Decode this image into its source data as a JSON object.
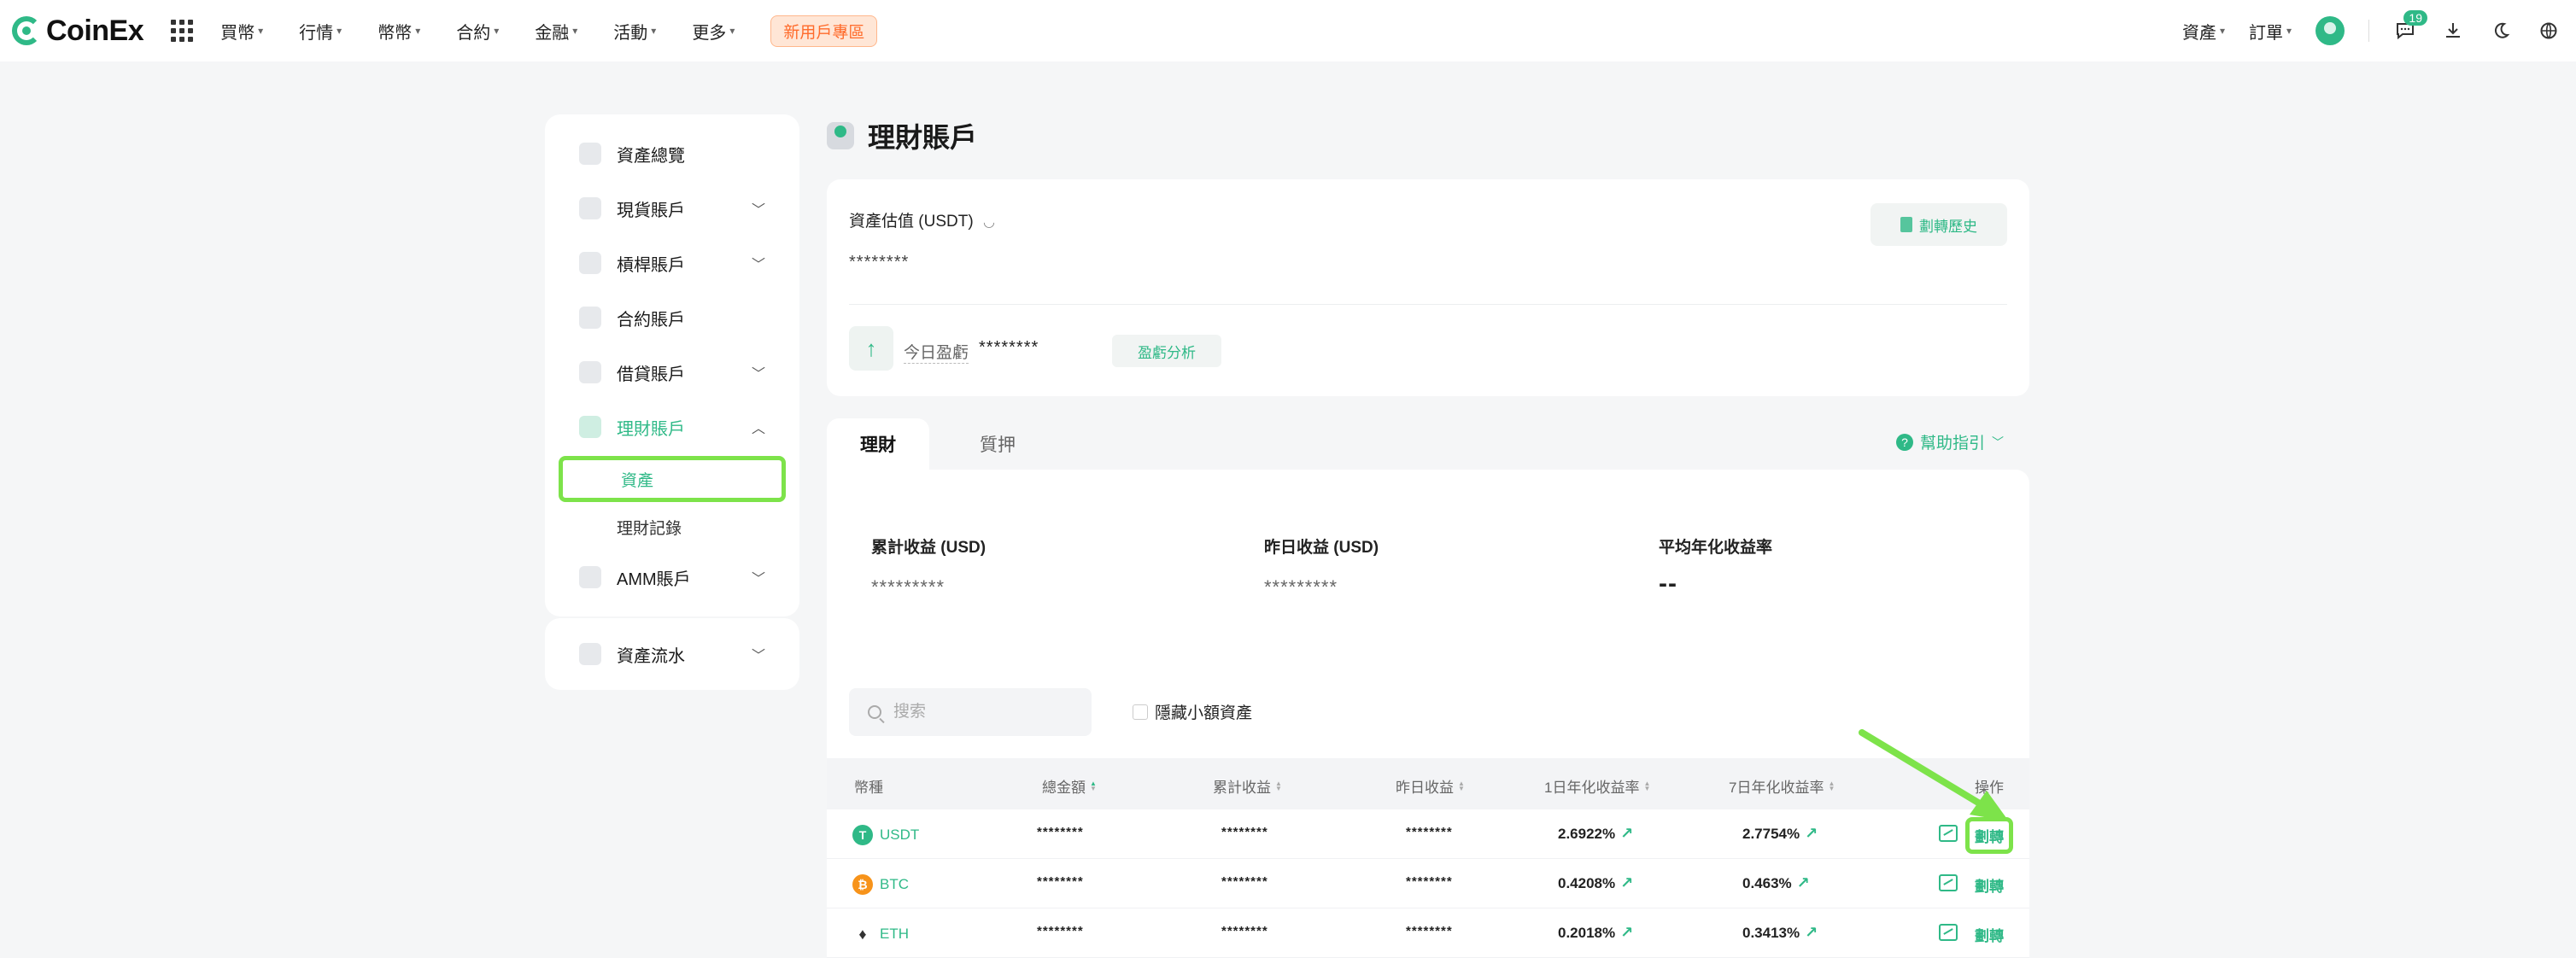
{
  "header": {
    "logo_text": "CoinEx",
    "nav": [
      "買幣",
      "行情",
      "幣幣",
      "合約",
      "金融",
      "活動",
      "更多"
    ],
    "promo": "新用戶專區",
    "right": {
      "assets": "資產",
      "orders": "訂單",
      "notifications_count": "19"
    }
  },
  "sidebar": {
    "items": [
      {
        "label": "資產總覽",
        "icon": "overview-icon",
        "expandable": false
      },
      {
        "label": "現貨賬戶",
        "icon": "spot-icon",
        "expandable": true
      },
      {
        "label": "槓桿賬戶",
        "icon": "margin-icon",
        "expandable": true
      },
      {
        "label": "合約賬戶",
        "icon": "futures-icon",
        "expandable": false
      },
      {
        "label": "借貸賬戶",
        "icon": "loan-icon",
        "expandable": true
      },
      {
        "label": "理財賬戶",
        "icon": "financial-icon",
        "expandable": true,
        "active": true
      }
    ],
    "sub": {
      "assets": "資產",
      "records": "理財記錄"
    },
    "amm": "AMM賬戶",
    "flow": "資產流水"
  },
  "page": {
    "title": "理財賬戶"
  },
  "summary": {
    "asset_label": "資產估值 (USDT)",
    "asset_value": "********",
    "history_btn": "劃轉歷史",
    "today_label": "今日盈虧",
    "today_value": "********",
    "analysis_btn": "盈虧分析"
  },
  "tabs": {
    "tab1": "理財",
    "tab2": "質押",
    "help": "幫助指引"
  },
  "stats": {
    "cum_label": "累計收益 (USD)",
    "cum_value": "*********",
    "yest_label": "昨日收益 (USD)",
    "yest_value": "*********",
    "apy_label": "平均年化收益率",
    "apy_value": "--"
  },
  "filters": {
    "search_placeholder": "搜索",
    "hide_small": "隱藏小額資產"
  },
  "table": {
    "headers": [
      "幣種",
      "總金額",
      "累計收益",
      "昨日收益",
      "1日年化收益率",
      "7日年化收益率",
      "操作"
    ],
    "rows": [
      {
        "coin": "USDT",
        "total": "********",
        "cum": "********",
        "yest": "********",
        "apy1": "2.6922%",
        "apy7": "2.7754%",
        "action": "劃轉"
      },
      {
        "coin": "BTC",
        "total": "********",
        "cum": "********",
        "yest": "********",
        "apy1": "0.4208%",
        "apy7": "0.463%",
        "action": "劃轉"
      },
      {
        "coin": "ETH",
        "total": "********",
        "cum": "********",
        "yest": "********",
        "apy1": "0.2018%",
        "apy7": "0.3413%",
        "action": "劃轉"
      }
    ]
  },
  "colors": {
    "brand": "#2fb987",
    "highlight": "#7de34a",
    "promo": "#ff6b2b"
  }
}
